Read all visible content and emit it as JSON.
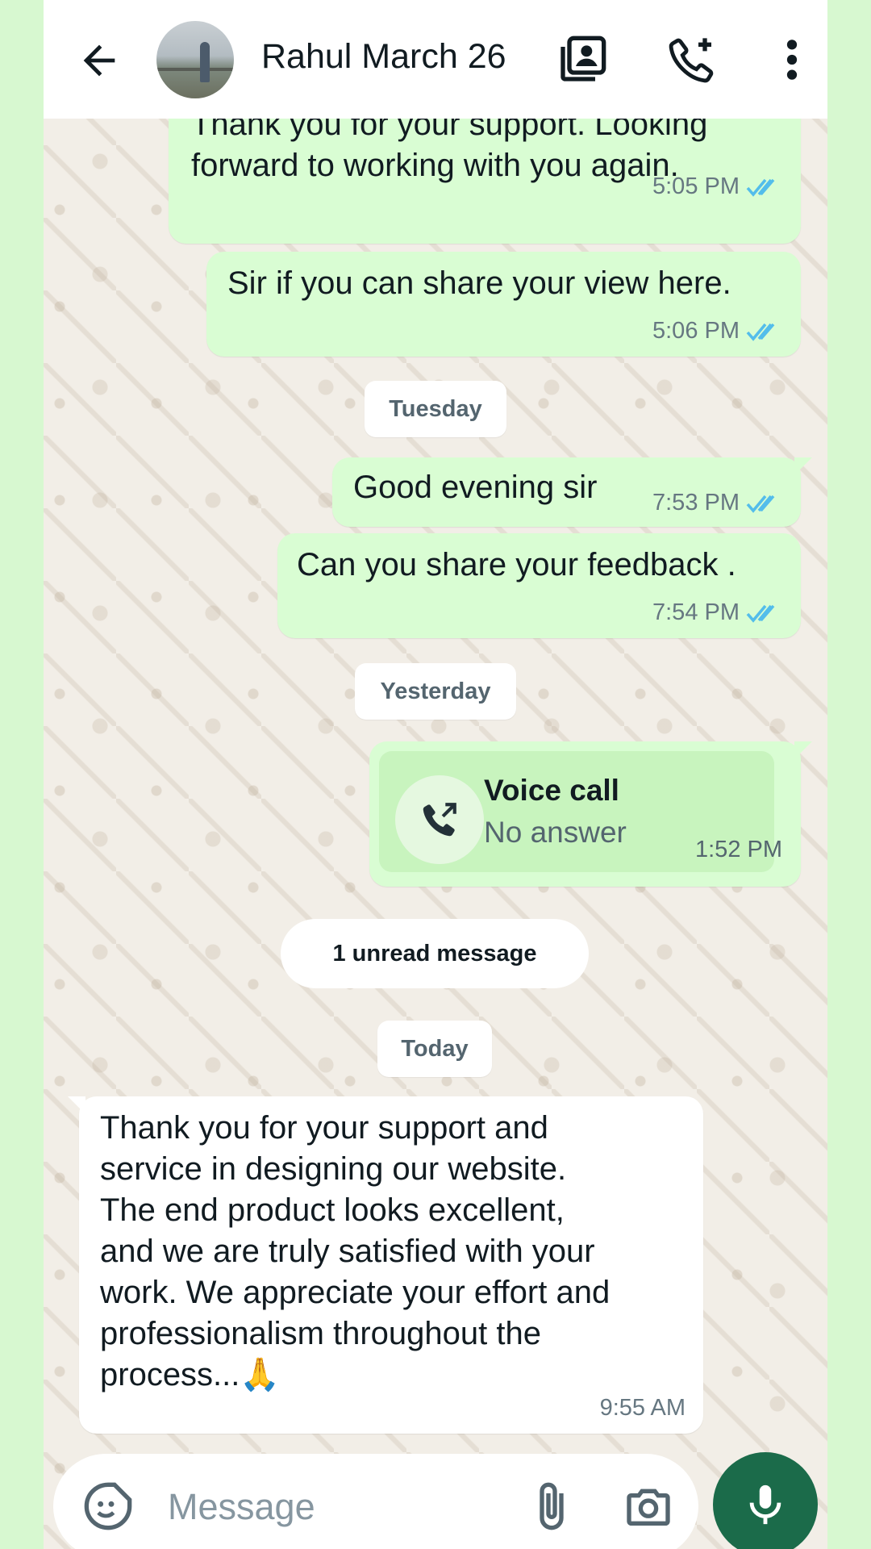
{
  "header": {
    "title": "Rahul March 26",
    "back_icon": "arrow-left-icon",
    "icons": [
      "contact-card-icon",
      "add-call-icon",
      "more-vert-icon"
    ]
  },
  "messages": {
    "m1": {
      "text": "Thank you for your support. Looking\nforward to working with you again.",
      "time": "5:05 PM"
    },
    "m2": {
      "text": "Sir if you can share your view here.",
      "time": "5:06 PM"
    },
    "d1": "Tuesday",
    "m3": {
      "text": "Good evening sir",
      "time": "7:53 PM"
    },
    "m4": {
      "text": "Can you share your feedback .",
      "time": "7:54 PM"
    },
    "d2": "Yesterday",
    "call": {
      "title": "Voice call",
      "subtitle": "No answer",
      "time": "1:52 PM"
    },
    "unread": "1 unread message",
    "d3": "Today",
    "m5": {
      "text": "Thank you for your support and\nservice in designing our website.\nThe end product looks excellent,\nand we are truly satisfied with your\nwork. We appreciate your effort and\nprofessionalism throughout the\nprocess...🙏",
      "time": "9:55 AM"
    }
  },
  "composer": {
    "placeholder": "Message"
  },
  "colors": {
    "outgoing": "#d9fdd3",
    "incoming": "#ffffff",
    "read_ticks": "#53bdeb",
    "mic_button": "#1b6b4a"
  }
}
